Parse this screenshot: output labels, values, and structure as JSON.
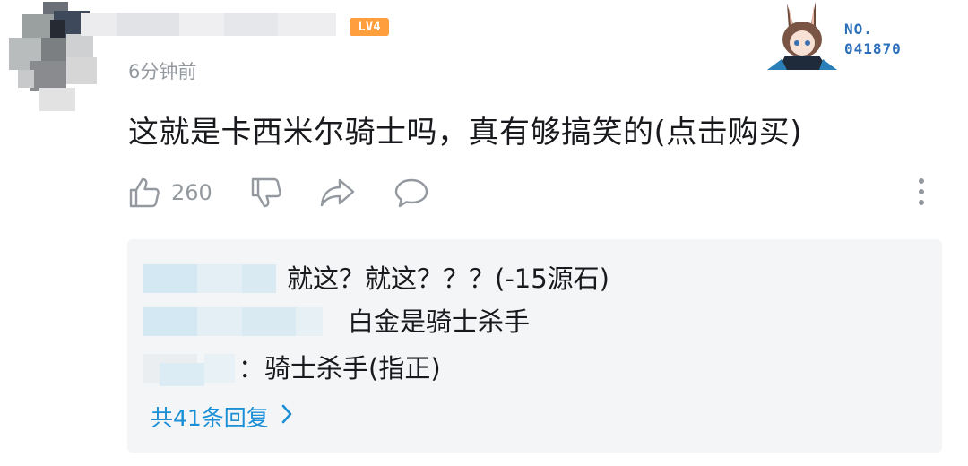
{
  "comment": {
    "level_badge": "LV4",
    "timestamp": "6分钟前",
    "text": "这就是卡西米尔骑士吗，真有够搞笑的(点击购买)",
    "medal_label_line1": "NO.",
    "medal_label_line2": "041870",
    "like_count": "260",
    "icons": {
      "like": "thumbs-up-icon",
      "dislike": "thumbs-down-icon",
      "share": "share-icon",
      "reply": "comment-bubble-icon",
      "more": "more-vertical-icon",
      "chevron": "chevron-right-icon"
    }
  },
  "replies": [
    {
      "text": "就这？就这？？？(-15源石)"
    },
    {
      "text": "白金是骑士杀手"
    },
    {
      "text": "：骑士杀手(指正)"
    }
  ],
  "more_replies_label": "共41条回复",
  "colors": {
    "accent_link": "#1a8fd6",
    "muted": "#9499a0",
    "level_badge": "#ff9e3c",
    "reply_bg": "#f4f5f7"
  }
}
